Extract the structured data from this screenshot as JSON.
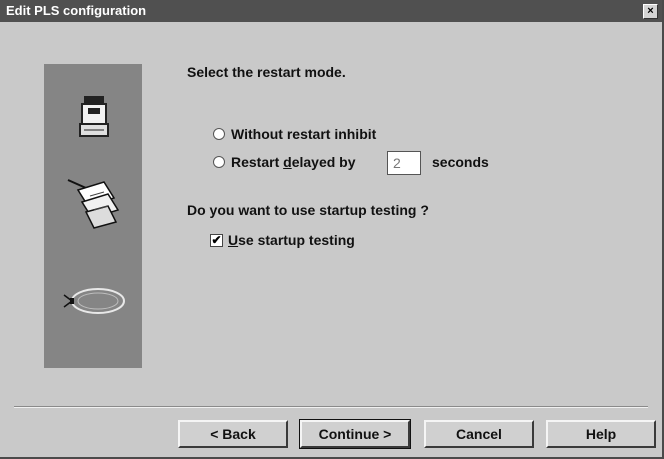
{
  "window": {
    "title": "Edit PLS configuration",
    "close_glyph": "×"
  },
  "content": {
    "prompt": "Select the restart mode.",
    "restart_modes": [
      {
        "label": "Without restart inhibit",
        "selected": false
      },
      {
        "label_prefix": "Restart ",
        "label_mnemonic": "d",
        "label_suffix": "elayed by",
        "selected": false
      }
    ],
    "delay_value": "2",
    "seconds_label": "seconds",
    "startup_question": "Do you want to use startup testing ?",
    "startup_checkbox": {
      "mnemonic": "U",
      "label_rest": "se startup testing",
      "checked": true,
      "check_glyph": "✔"
    }
  },
  "buttons": {
    "back": "< Back",
    "continue": "Continue >",
    "cancel": "Cancel",
    "help": "Help"
  },
  "side_icons": [
    "scanner-device-icon",
    "configuration-cards-icon",
    "protective-field-icon"
  ]
}
